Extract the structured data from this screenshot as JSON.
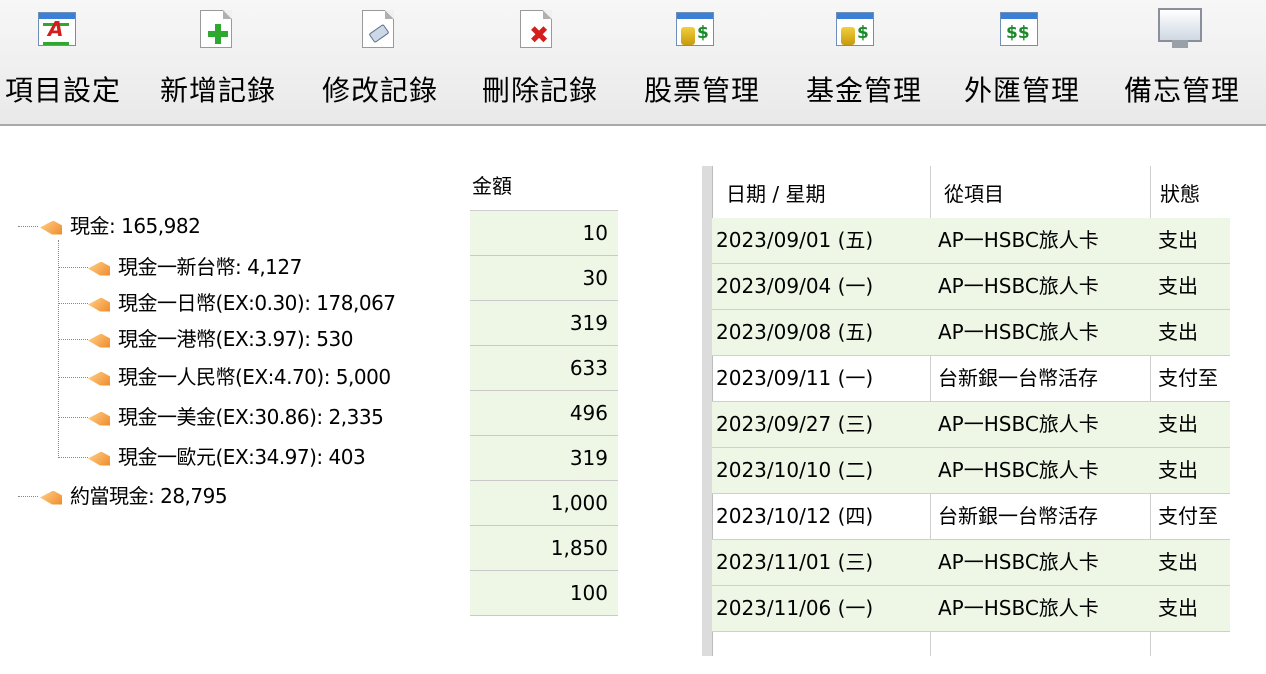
{
  "toolbar": {
    "buttons": [
      {
        "label": "項目設定",
        "icon": "project-settings-icon"
      },
      {
        "label": "新增記錄",
        "icon": "add-record-icon"
      },
      {
        "label": "修改記錄",
        "icon": "edit-record-icon"
      },
      {
        "label": "刪除記錄",
        "icon": "delete-record-icon"
      },
      {
        "label": "股票管理",
        "icon": "stock-management-icon"
      },
      {
        "label": "基金管理",
        "icon": "fund-management-icon"
      },
      {
        "label": "外匯管理",
        "icon": "forex-management-icon"
      },
      {
        "label": "備忘管理",
        "icon": "memo-management-icon"
      }
    ]
  },
  "tree": {
    "root": "現金: 165,982",
    "children": [
      "現金一新台幣: 4,127",
      "現金一日幣(EX:0.30): 178,067",
      "現金一港幣(EX:3.97): 530",
      "現金一人民幣(EX:4.70): 5,000",
      "現金一美金(EX:30.86): 2,335",
      "現金一歐元(EX:34.97): 403"
    ],
    "second_root": "約當現金: 28,795"
  },
  "amount_column": {
    "header": "金額",
    "values": [
      "10",
      "30",
      "319",
      "633",
      "496",
      "319",
      "1,000",
      "1,850",
      "100"
    ]
  },
  "records": {
    "columns": [
      "日期 / 星期",
      "從項目",
      "狀態"
    ],
    "rows": [
      [
        "2023/09/01 (五)",
        "AP一HSBC旅人卡",
        "支出"
      ],
      [
        "2023/09/04 (一)",
        "AP一HSBC旅人卡",
        "支出"
      ],
      [
        "2023/09/08 (五)",
        "AP一HSBC旅人卡",
        "支出"
      ],
      [
        "2023/09/11 (一)",
        "台新銀一台幣活存",
        "支付至"
      ],
      [
        "2023/09/27 (三)",
        "AP一HSBC旅人卡",
        "支出"
      ],
      [
        "2023/10/10 (二)",
        "AP一HSBC旅人卡",
        "支出"
      ],
      [
        "2023/10/12 (四)",
        "台新銀一台幣活存",
        "支付至"
      ],
      [
        "2023/11/01 (三)",
        "AP一HSBC旅人卡",
        "支出"
      ],
      [
        "2023/11/06 (一)",
        "AP一HSBC旅人卡",
        "支出"
      ]
    ]
  }
}
